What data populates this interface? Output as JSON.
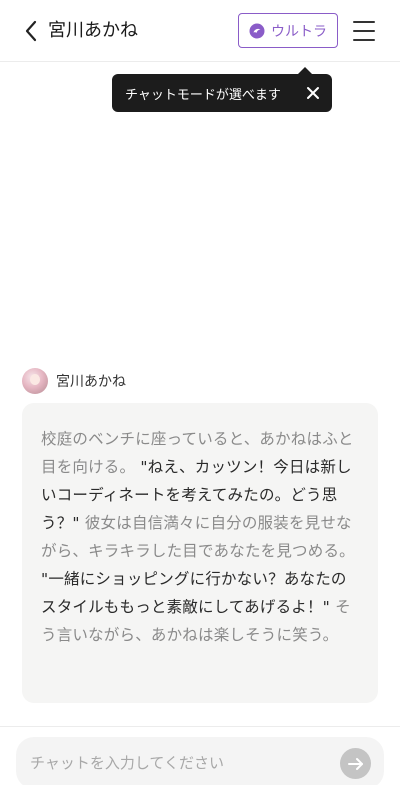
{
  "header": {
    "title": "宮川あかね",
    "mode_button_label": "ウルトラ"
  },
  "tooltip": {
    "text": "チャットモードが選べます"
  },
  "message": {
    "speaker": "宮川あかね",
    "segments": [
      {
        "type": "narration",
        "text": "校庭のベンチに座っていると、あかねはふと目を向ける。"
      },
      {
        "type": "dialog",
        "text": " \"ねえ、カッツン！今日は新しいコーディネートを考えてみたの。どう思う？\" "
      },
      {
        "type": "narration",
        "text": "彼女は自信満々に自分の服装を見せながら、キラキラした目であなたを見つめる。"
      },
      {
        "type": "dialog",
        "text": " \"一緒にショッピングに行かない？あなたのスタイルももっと素敵にしてあげるよ！\" "
      },
      {
        "type": "narration",
        "text": "そう言いながら、あかねは楽しそうに笑う。"
      }
    ]
  },
  "input": {
    "placeholder": "チャットを入力してください"
  },
  "colors": {
    "accent": "#8a5cc8",
    "tooltip_bg": "#1c1c1c",
    "bubble_bg": "#f5f5f4",
    "narration_text": "#8a8a8a",
    "dialog_text": "#2a2a2a"
  },
  "icons": {
    "back": "chevron-left-icon",
    "mode": "ultra-mode-icon",
    "menu": "hamburger-menu-icon",
    "close": "close-icon",
    "send": "arrow-right-icon"
  }
}
